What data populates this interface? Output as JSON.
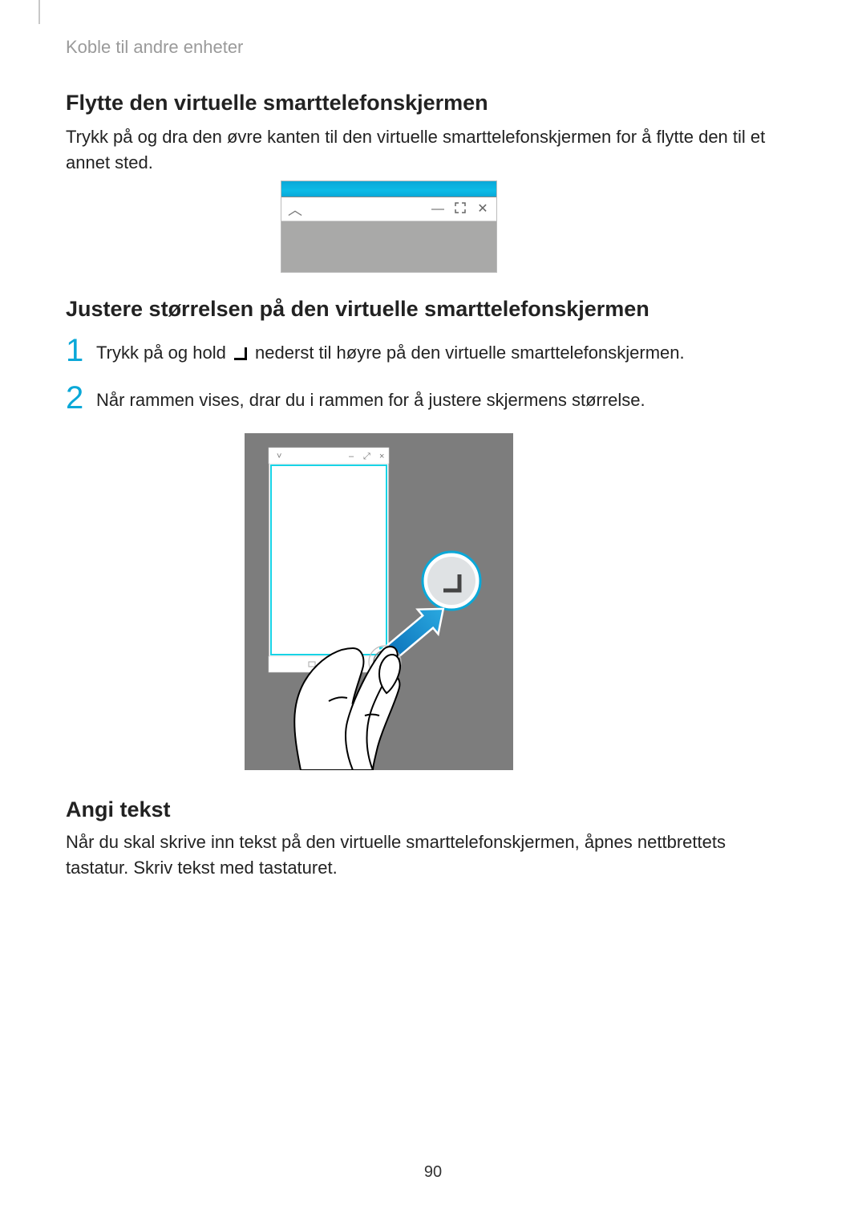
{
  "breadcrumb": "Koble til andre enheter",
  "section1": {
    "heading": "Flytte den virtuelle smarttelefonskjermen",
    "paragraph": "Trykk på og dra den øvre kanten til den virtuelle smarttelefonskjermen for å flytte den til et annet sted."
  },
  "section2": {
    "heading": "Justere størrelsen på den virtuelle smarttelefonskjermen",
    "step1_num": "1",
    "step1_a": "Trykk på og hold ",
    "step1_b": " nederst til høyre på den virtuelle smarttelefonskjermen.",
    "step2_num": "2",
    "step2": "Når rammen vises, drar du i rammen for å justere skjermens størrelse."
  },
  "section3": {
    "heading": "Angi tekst",
    "paragraph": "Når du skal skrive inn tekst på den virtuelle smarttelefonskjermen, åpnes nettbrettets tastatur. Skriv tekst med tastaturet."
  },
  "pageNumber": "90"
}
